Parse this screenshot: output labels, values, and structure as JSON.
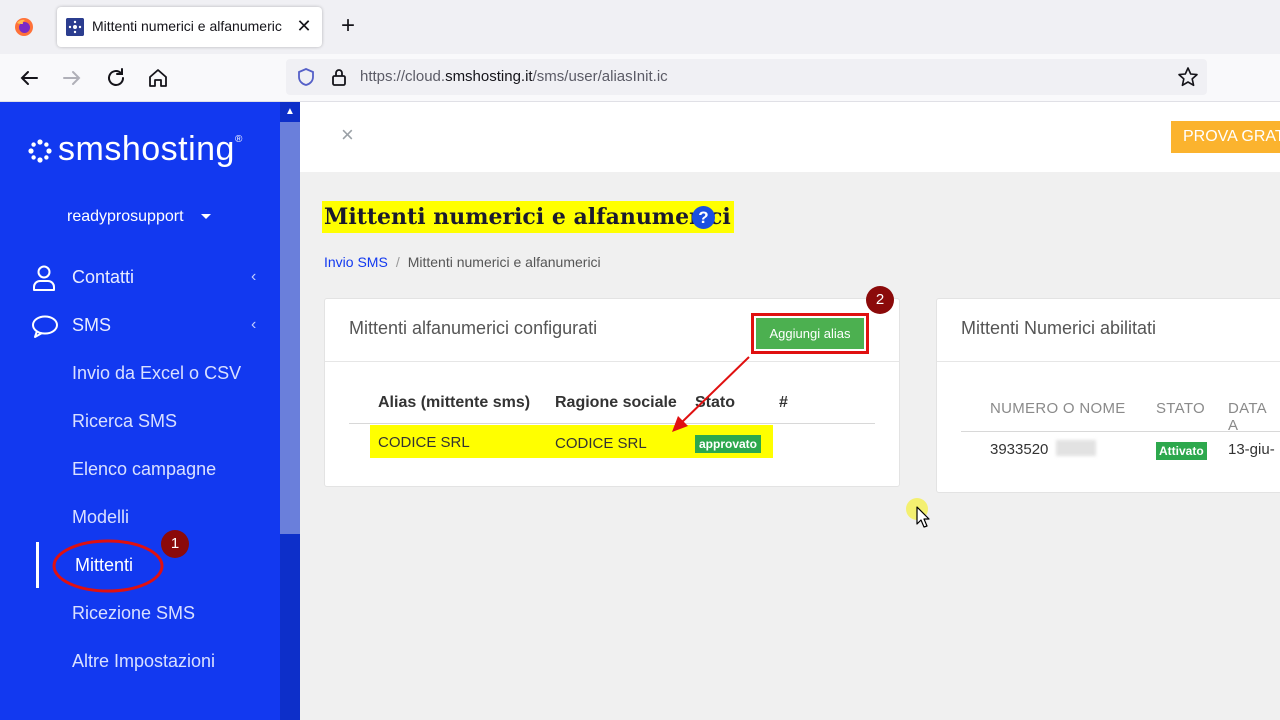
{
  "browser": {
    "tab_title": "Mittenti numerici e alfanumeric",
    "url_prefix": "https://cloud.",
    "url_domain": "smshosting.it",
    "url_path": "/sms/user/aliasInit.ic"
  },
  "sidebar": {
    "brand": "smshosting",
    "brand_mark": "®",
    "user": "readyprosupport",
    "items": [
      {
        "label": "Contatti"
      },
      {
        "label": "SMS"
      }
    ],
    "sub_items": [
      {
        "label": "Invio da Excel o CSV"
      },
      {
        "label": "Ricerca SMS"
      },
      {
        "label": "Elenco campagne"
      },
      {
        "label": "Modelli"
      },
      {
        "label": "Mittenti"
      },
      {
        "label": "Ricezione SMS"
      },
      {
        "label": "Altre Impostazioni"
      }
    ]
  },
  "topbar": {
    "close": "×",
    "cta": "PROVA GRATIS"
  },
  "page": {
    "title": "Mittenti numerici e alfanumerici",
    "help": "?",
    "breadcrumb": [
      {
        "label": "Invio SMS"
      },
      {
        "label": "Mittenti numerici e alfanumerici"
      }
    ],
    "breadcrumb_sep": "/"
  },
  "alfa_card": {
    "title": "Mittenti alfanumerici configurati",
    "add_button": "Aggiungi alias",
    "columns": [
      "Alias (mittente sms)",
      "Ragione sociale",
      "Stato",
      "#"
    ],
    "rows": [
      {
        "alias": "CODICE SRL",
        "ragione": "CODICE SRL",
        "stato": "approvato"
      }
    ]
  },
  "num_card": {
    "title": "Mittenti Numerici abilitati",
    "columns": [
      "NUMERO O NOME",
      "STATO",
      "DATA A"
    ],
    "rows": [
      {
        "numero": "3933520",
        "stato": "Attivato",
        "data": "13-giu-"
      }
    ]
  },
  "annotations": {
    "step1": "1",
    "step2": "2"
  },
  "colors": {
    "sidebar": "#1239f0",
    "highlight": "#ffff00",
    "annotation": "#e01010",
    "success": "#2da84d"
  }
}
